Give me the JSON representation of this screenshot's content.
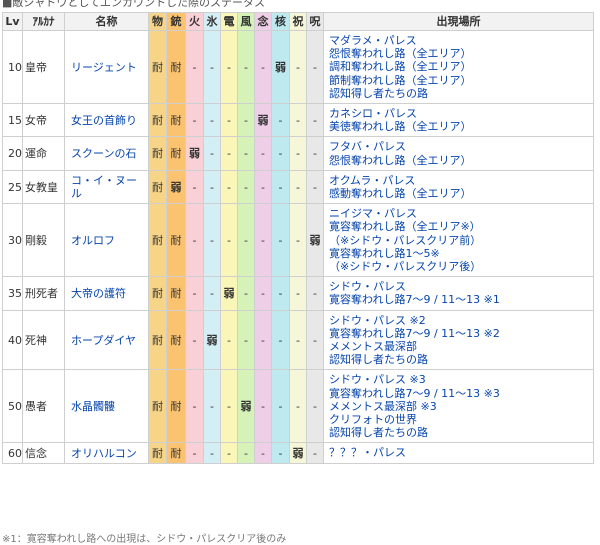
{
  "caption": "■敵シャドウとしてエンカウントした際のステータス",
  "headers": {
    "lv": "Lv",
    "arcana": "ｱﾙｶﾅ",
    "name": "名称",
    "phys": "物",
    "gun": "銃",
    "fire": "火",
    "ice": "氷",
    "elec": "電",
    "wind": "風",
    "psy": "念",
    "nuke": "核",
    "bless": "祝",
    "curse": "呪",
    "location": "出現場所"
  },
  "rows": [
    {
      "lv": "10",
      "arcana": "皇帝",
      "name": "リージェント",
      "affinities": [
        "耐",
        "耐",
        "-",
        "-",
        "-",
        "-",
        "-",
        "弱",
        "-",
        "-"
      ],
      "locations": [
        {
          "text": "マダラメ・パレス"
        },
        {
          "text": "怨恨奪われし路（全エリア）"
        },
        {
          "text": "調和奪われし路（全エリア）"
        },
        {
          "text": "節制奪われし路（全エリア）"
        },
        {
          "text": "認知得し者たちの路"
        }
      ]
    },
    {
      "lv": "15",
      "arcana": "女帝",
      "name": "女王の首飾り",
      "affinities": [
        "耐",
        "耐",
        "-",
        "-",
        "-",
        "-",
        "弱",
        "-",
        "-",
        "-"
      ],
      "locations": [
        {
          "text": "カネシロ・パレス"
        },
        {
          "text": "美徳奪われし路（全エリア）"
        }
      ]
    },
    {
      "lv": "20",
      "arcana": "運命",
      "name": "スクーンの石",
      "affinities": [
        "耐",
        "耐",
        "弱",
        "-",
        "-",
        "-",
        "-",
        "-",
        "-",
        "-"
      ],
      "locations": [
        {
          "text": "フタバ・パレス"
        },
        {
          "text": "怨恨奪われし路（全エリア）"
        }
      ]
    },
    {
      "lv": "25",
      "arcana": "女教皇",
      "name": "コ・イ・ヌール",
      "affinities": [
        "耐",
        "弱",
        "-",
        "-",
        "-",
        "-",
        "-",
        "-",
        "-",
        "-"
      ],
      "locations": [
        {
          "text": "オクムラ・パレス"
        },
        {
          "text": "感動奪われし路（全エリア）"
        }
      ]
    },
    {
      "lv": "30",
      "arcana": "剛毅",
      "name": "オルロフ",
      "affinities": [
        "耐",
        "耐",
        "-",
        "-",
        "-",
        "-",
        "-",
        "-",
        "-",
        "弱"
      ],
      "locations": [
        {
          "text": "ニイジマ・パレス"
        },
        {
          "text": "寛容奪われし路（全エリア※）"
        },
        {
          "text": "（※シドウ・パレスクリア前）"
        },
        {
          "text": "寛容奪われし路1～5※"
        },
        {
          "text": "（※シドウ・パレスクリア後）"
        }
      ]
    },
    {
      "lv": "35",
      "arcana": "刑死者",
      "name": "大帝の護符",
      "affinities": [
        "耐",
        "耐",
        "-",
        "-",
        "弱",
        "-",
        "-",
        "-",
        "-",
        "-"
      ],
      "locations": [
        {
          "text": "シドウ・パレス"
        },
        {
          "text": "寛容奪われし路7～9 / 11～13 ※1"
        }
      ]
    },
    {
      "lv": "40",
      "arcana": "死神",
      "name": "ホープダイヤ",
      "affinities": [
        "耐",
        "耐",
        "-",
        "弱",
        "-",
        "-",
        "-",
        "-",
        "-",
        "-"
      ],
      "locations": [
        {
          "text": "シドウ・パレス ※2"
        },
        {
          "text": "寛容奪われし路7～9 / 11～13 ※2"
        },
        {
          "text": "メメントス最深部"
        },
        {
          "text": "認知得し者たちの路"
        }
      ]
    },
    {
      "lv": "50",
      "arcana": "愚者",
      "name": "水晶髑髏",
      "affinities": [
        "耐",
        "耐",
        "-",
        "-",
        "-",
        "弱",
        "-",
        "-",
        "-",
        "-"
      ],
      "locations": [
        {
          "text": "シドウ・パレス ※3"
        },
        {
          "text": "寛容奪われし路7～9 / 11～13 ※3"
        },
        {
          "text": "メメントス最深部 ※3"
        },
        {
          "text": "クリフォトの世界"
        },
        {
          "text": "認知得し者たちの路"
        }
      ]
    },
    {
      "lv": "60",
      "arcana": "信念",
      "name": "オリハルコン",
      "affinities": [
        "耐",
        "耐",
        "-",
        "-",
        "-",
        "-",
        "-",
        "-",
        "弱",
        "-"
      ],
      "locations": [
        {
          "text": "？？？・パレス"
        }
      ]
    }
  ],
  "footnote": "※1：寛容奪われし路への出現は、シドウ・パレスクリア後のみ"
}
